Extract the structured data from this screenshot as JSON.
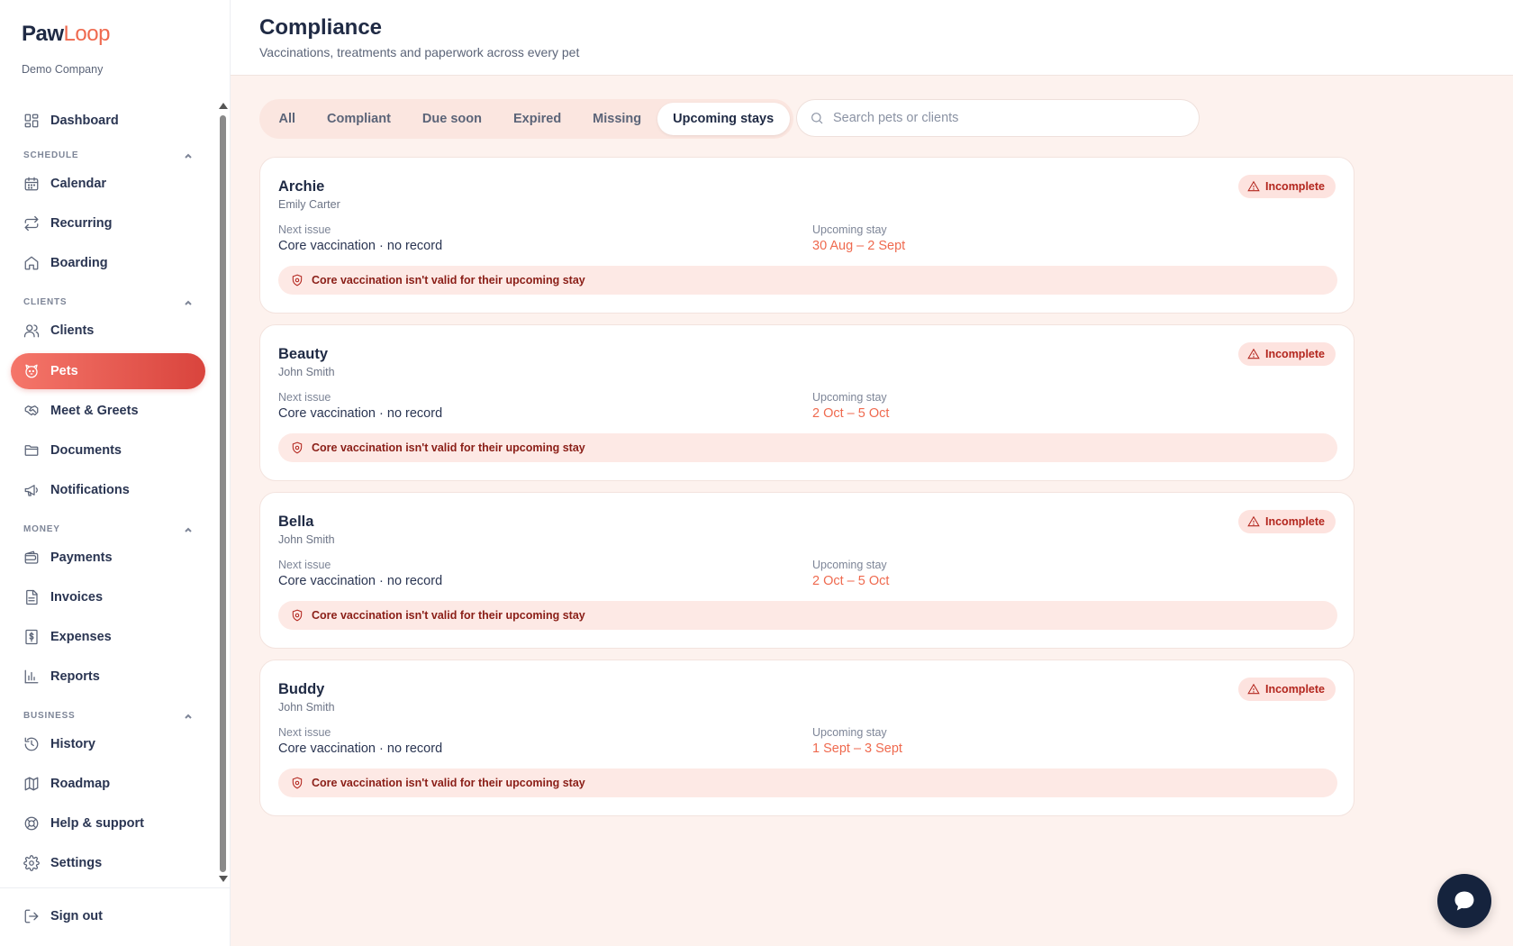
{
  "brand": {
    "name_part1": "Paw",
    "name_part2": "Loop",
    "company": "Demo Company",
    "accent_color": "#ef6a4f"
  },
  "sidebar": {
    "top_items": [
      {
        "label": "Dashboard",
        "icon": "dashboard-icon"
      }
    ],
    "sections": [
      {
        "label": "SCHEDULE",
        "items": [
          {
            "label": "Calendar",
            "icon": "calendar-icon"
          },
          {
            "label": "Recurring",
            "icon": "repeat-icon"
          },
          {
            "label": "Boarding",
            "icon": "home-icon"
          }
        ]
      },
      {
        "label": "CLIENTS",
        "items": [
          {
            "label": "Clients",
            "icon": "users-icon"
          },
          {
            "label": "Pets",
            "icon": "paw-icon",
            "active": true
          },
          {
            "label": "Meet & Greets",
            "icon": "handshake-icon"
          },
          {
            "label": "Documents",
            "icon": "folder-icon"
          },
          {
            "label": "Notifications",
            "icon": "megaphone-icon"
          }
        ]
      },
      {
        "label": "MONEY",
        "items": [
          {
            "label": "Payments",
            "icon": "wallet-icon"
          },
          {
            "label": "Invoices",
            "icon": "file-icon"
          },
          {
            "label": "Expenses",
            "icon": "dollar-receipt-icon"
          },
          {
            "label": "Reports",
            "icon": "bar-chart-icon"
          }
        ]
      },
      {
        "label": "BUSINESS",
        "items": [
          {
            "label": "History",
            "icon": "history-icon"
          },
          {
            "label": "Roadmap",
            "icon": "map-icon"
          },
          {
            "label": "Help & support",
            "icon": "lifebuoy-icon"
          },
          {
            "label": "Settings",
            "icon": "gear-icon"
          }
        ]
      }
    ],
    "sign_out": "Sign out"
  },
  "header": {
    "title": "Compliance",
    "subtitle": "Vaccinations, treatments and paperwork across every pet"
  },
  "filters": {
    "tabs": [
      "All",
      "Compliant",
      "Due soon",
      "Expired",
      "Missing",
      "Upcoming stays"
    ],
    "active_tab": "Upcoming stays",
    "search_placeholder": "Search pets or clients",
    "search_value": ""
  },
  "labels": {
    "next_issue": "Next issue",
    "upcoming_stay": "Upcoming stay"
  },
  "cards": [
    {
      "pet": "Archie",
      "owner": "Emily Carter",
      "status": "Incomplete",
      "next_issue": "Core vaccination · no record",
      "stay": "30 Aug – 2 Sept",
      "warning": "Core vaccination isn't valid for their upcoming stay"
    },
    {
      "pet": "Beauty",
      "owner": "John Smith",
      "status": "Incomplete",
      "next_issue": "Core vaccination · no record",
      "stay": "2 Oct – 5 Oct",
      "warning": "Core vaccination isn't valid for their upcoming stay"
    },
    {
      "pet": "Bella",
      "owner": "John Smith",
      "status": "Incomplete",
      "next_issue": "Core vaccination · no record",
      "stay": "2 Oct – 5 Oct",
      "warning": "Core vaccination isn't valid for their upcoming stay"
    },
    {
      "pet": "Buddy",
      "owner": "John Smith",
      "status": "Incomplete",
      "next_issue": "Core vaccination · no record",
      "stay": "1 Sept – 3 Sept",
      "warning": "Core vaccination isn't valid for their upcoming stay"
    }
  ]
}
